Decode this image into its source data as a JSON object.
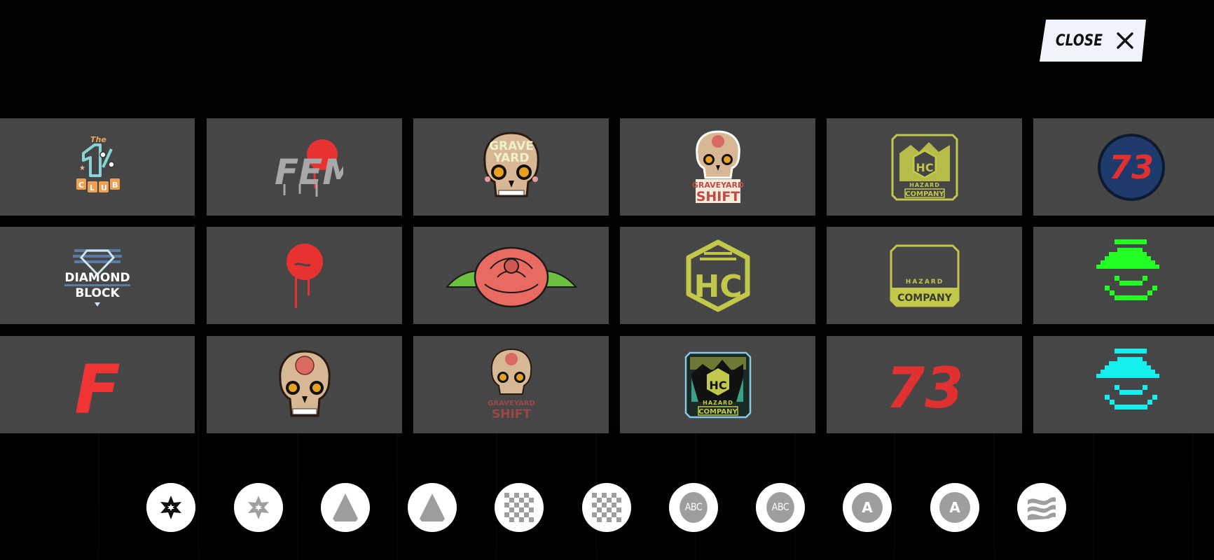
{
  "close_button": {
    "label": "CLOSE",
    "icon": "close-icon"
  },
  "decals": [
    {
      "row": 0,
      "col": 0,
      "name": "The 1% Club",
      "texts": [
        "The",
        "%",
        "C",
        "L",
        "U",
        "B"
      ],
      "icon": "one-percent-club-logo",
      "colors": [
        "#8ad3d8",
        "#f0a050",
        "#e8a85a"
      ]
    },
    {
      "row": 0,
      "col": 1,
      "name": "FEM",
      "texts": [
        "FEM"
      ],
      "icon": "fem-graffiti-logo",
      "colors": [
        "#a8a8a8",
        "#e83232"
      ]
    },
    {
      "row": 0,
      "col": 2,
      "name": "Grave Yard",
      "texts": [
        "GRAVE",
        "YARD"
      ],
      "icon": "sugar-skull-graveyard-logo",
      "colors": [
        "#d8b894",
        "#e8f0c0",
        "#e8a020"
      ]
    },
    {
      "row": 0,
      "col": 3,
      "name": "Graveyard Shift",
      "texts": [
        "GRAVEYARD",
        "SHIFT"
      ],
      "icon": "graveyard-shift-skull-logo",
      "colors": [
        "#d8b894",
        "#c04848"
      ]
    },
    {
      "row": 0,
      "col": 4,
      "name": "Hazard Company Badge",
      "texts": [
        "HAZARD",
        "COMPANY"
      ],
      "icon": "hazard-company-badge-logo",
      "colors": [
        "#c2c84a"
      ]
    },
    {
      "row": 0,
      "col": 5,
      "name": "73 Circle",
      "texts": [
        "73"
      ],
      "icon": "number-73-circle-logo",
      "colors": [
        "#1e3a6a",
        "#e03030"
      ]
    },
    {
      "row": 1,
      "col": 0,
      "name": "Diamond Block",
      "texts": [
        "DIAMOND",
        "BLOCK"
      ],
      "icon": "diamond-block-logo",
      "colors": [
        "#5a7aa8",
        "#ffffff"
      ]
    },
    {
      "row": 1,
      "col": 1,
      "name": "Red Drip Circle",
      "texts": [],
      "icon": "red-drip-circle-logo",
      "colors": [
        "#e83232"
      ]
    },
    {
      "row": 1,
      "col": 2,
      "name": "Rose",
      "texts": [],
      "icon": "rose-logo",
      "colors": [
        "#e86a60",
        "#6cc040"
      ]
    },
    {
      "row": 1,
      "col": 3,
      "name": "HC Cube",
      "texts": [
        "HC"
      ],
      "icon": "hc-cube-logo",
      "colors": [
        "#c2c84a"
      ]
    },
    {
      "row": 1,
      "col": 4,
      "name": "Hazard Company Plate",
      "texts": [
        "HAZARD",
        "COMPANY"
      ],
      "icon": "hazard-company-plate-logo",
      "colors": [
        "#c2c84a"
      ]
    },
    {
      "row": 1,
      "col": 5,
      "name": "Pixel Lamp Green",
      "texts": [],
      "icon": "pixel-lamp-face-logo",
      "colors": [
        "#22ff22"
      ]
    },
    {
      "row": 2,
      "col": 0,
      "name": "Red F",
      "texts": [
        "F"
      ],
      "icon": "red-f-logo",
      "colors": [
        "#f03434"
      ]
    },
    {
      "row": 2,
      "col": 1,
      "name": "Rose Skull",
      "texts": [],
      "icon": "rose-sugar-skull-logo",
      "colors": [
        "#d8b894",
        "#d86a60"
      ]
    },
    {
      "row": 2,
      "col": 2,
      "name": "Graveyard Shift Faded",
      "texts": [
        "GRAVEYARD",
        "SHIFT"
      ],
      "icon": "graveyard-shift-faded-logo",
      "colors": [
        "#d8b894",
        "#b04848"
      ]
    },
    {
      "row": 2,
      "col": 3,
      "name": "Hazard Company Color Badge",
      "texts": [
        "HAZARD",
        "COMPANY"
      ],
      "icon": "hazard-company-color-badge-logo",
      "colors": [
        "#c2c84a",
        "#3aa088",
        "#8ac8e8"
      ]
    },
    {
      "row": 2,
      "col": 4,
      "name": "73 Red",
      "texts": [
        "73"
      ],
      "icon": "number-73-logo",
      "colors": [
        "#e03030"
      ]
    },
    {
      "row": 2,
      "col": 5,
      "name": "Pixel Lamp Cyan",
      "texts": [],
      "icon": "pixel-lamp-face-logo",
      "colors": [
        "#14f0f0"
      ]
    }
  ],
  "toolbar": [
    {
      "icon": "star-solid-icon",
      "style": "dark"
    },
    {
      "icon": "star-outline-icon",
      "style": "grey"
    },
    {
      "icon": "cone-icon",
      "style": "grey"
    },
    {
      "icon": "cone-icon",
      "style": "grey"
    },
    {
      "icon": "checker-pattern-icon",
      "style": "grey"
    },
    {
      "icon": "checker-pattern-icon",
      "style": "grey"
    },
    {
      "icon": "abc-font-icon",
      "label": "ABC"
    },
    {
      "icon": "abc-font-icon",
      "label": "ABC"
    },
    {
      "icon": "letter-a-icon",
      "label": "A"
    },
    {
      "icon": "letter-a-icon",
      "label": "A"
    },
    {
      "icon": "wave-pattern-icon",
      "style": "grey"
    }
  ]
}
